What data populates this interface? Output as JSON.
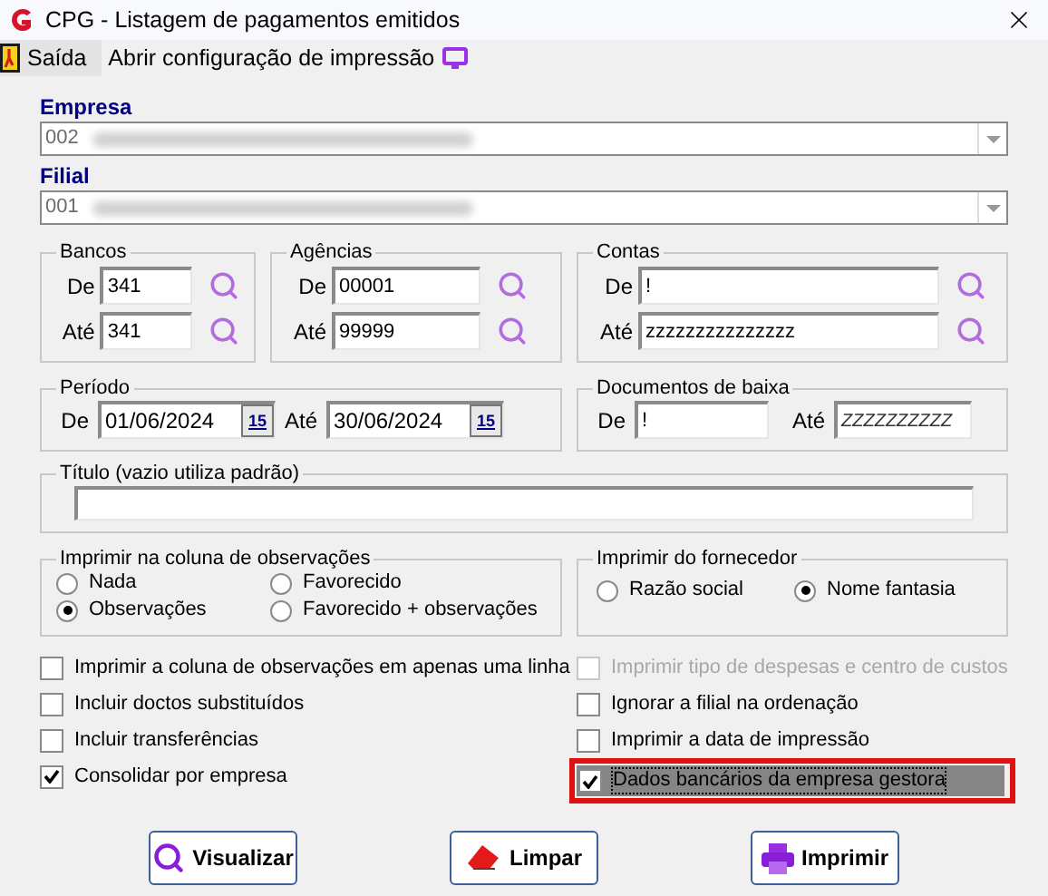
{
  "window": {
    "title": "CPG - Listagem de pagamentos emitidos"
  },
  "menu": [
    {
      "label": "Saída",
      "kind": "exit"
    },
    {
      "label": "Abrir configuração de impressão",
      "kind": "config"
    }
  ],
  "empresa": {
    "label": "Empresa",
    "value": "002",
    "disabled": true
  },
  "filial": {
    "label": "Filial",
    "value": "001",
    "disabled": true
  },
  "ranges": [
    {
      "title": "Bancos",
      "kind": "short",
      "rows": [
        {
          "label": "De",
          "value": "341"
        },
        {
          "label": "Até",
          "value": "341"
        }
      ]
    },
    {
      "title": "Agências",
      "kind": "medium",
      "rows": [
        {
          "label": "De",
          "value": "00001"
        },
        {
          "label": "Até",
          "value": "99999"
        }
      ]
    },
    {
      "title": "Contas",
      "kind": "long",
      "rows": [
        {
          "label": "De",
          "value": "!"
        },
        {
          "label": "Até",
          "value": "zzzzzzzzzzzzzzz"
        }
      ]
    }
  ],
  "periodo": {
    "title": "Período",
    "from_label": "De",
    "from": "01/06/2024",
    "to_label": "Até",
    "to": "30/06/2024",
    "from_calendar": "15",
    "to_calendar": "15"
  },
  "documentos": {
    "title": "Documentos de baixa",
    "from_label": "De",
    "from": "!",
    "to_label": "Até",
    "to": "ZZZZZZZZZZ"
  },
  "titulo": {
    "title": "Título (vazio utiliza padrão)"
  },
  "observacoes": {
    "title": "Imprimir na coluna de observações",
    "options": [
      {
        "label": "Nada",
        "selected": false
      },
      {
        "label": "Favorecido",
        "selected": false
      },
      {
        "label": "Observações",
        "selected": true
      },
      {
        "label": "Favorecido + observações",
        "selected": false
      }
    ]
  },
  "fornecedor": {
    "title": "Imprimir do fornecedor",
    "options": [
      {
        "label": "Razão social",
        "selected": false
      },
      {
        "label": "Nome fantasia",
        "selected": true
      }
    ]
  },
  "checks_left": [
    {
      "label": "Imprimir a coluna de observações em apenas uma linha",
      "checked": false
    },
    {
      "label": "Incluir doctos substituídos",
      "checked": false
    },
    {
      "label": "Incluir transferências",
      "checked": false
    },
    {
      "label": "Consolidar por empresa",
      "checked": true
    }
  ],
  "checks_right": [
    {
      "label": "Imprimir tipo de despesas e centro de custos",
      "checked": false,
      "disabled": true,
      "highlighted": false
    },
    {
      "label": "Ignorar a filial na ordenação",
      "checked": false,
      "disabled": false,
      "highlighted": false
    },
    {
      "label": "Imprimir a data de impressão",
      "checked": false,
      "disabled": false,
      "highlighted": false
    },
    {
      "label": "Dados bancários da empresa gestora",
      "checked": true,
      "disabled": false,
      "highlighted": true
    }
  ],
  "buttons": [
    {
      "label": "Visualizar",
      "kind": "preview"
    },
    {
      "label": "Limpar",
      "kind": "clear"
    },
    {
      "label": "Imprimir",
      "kind": "print"
    }
  ]
}
